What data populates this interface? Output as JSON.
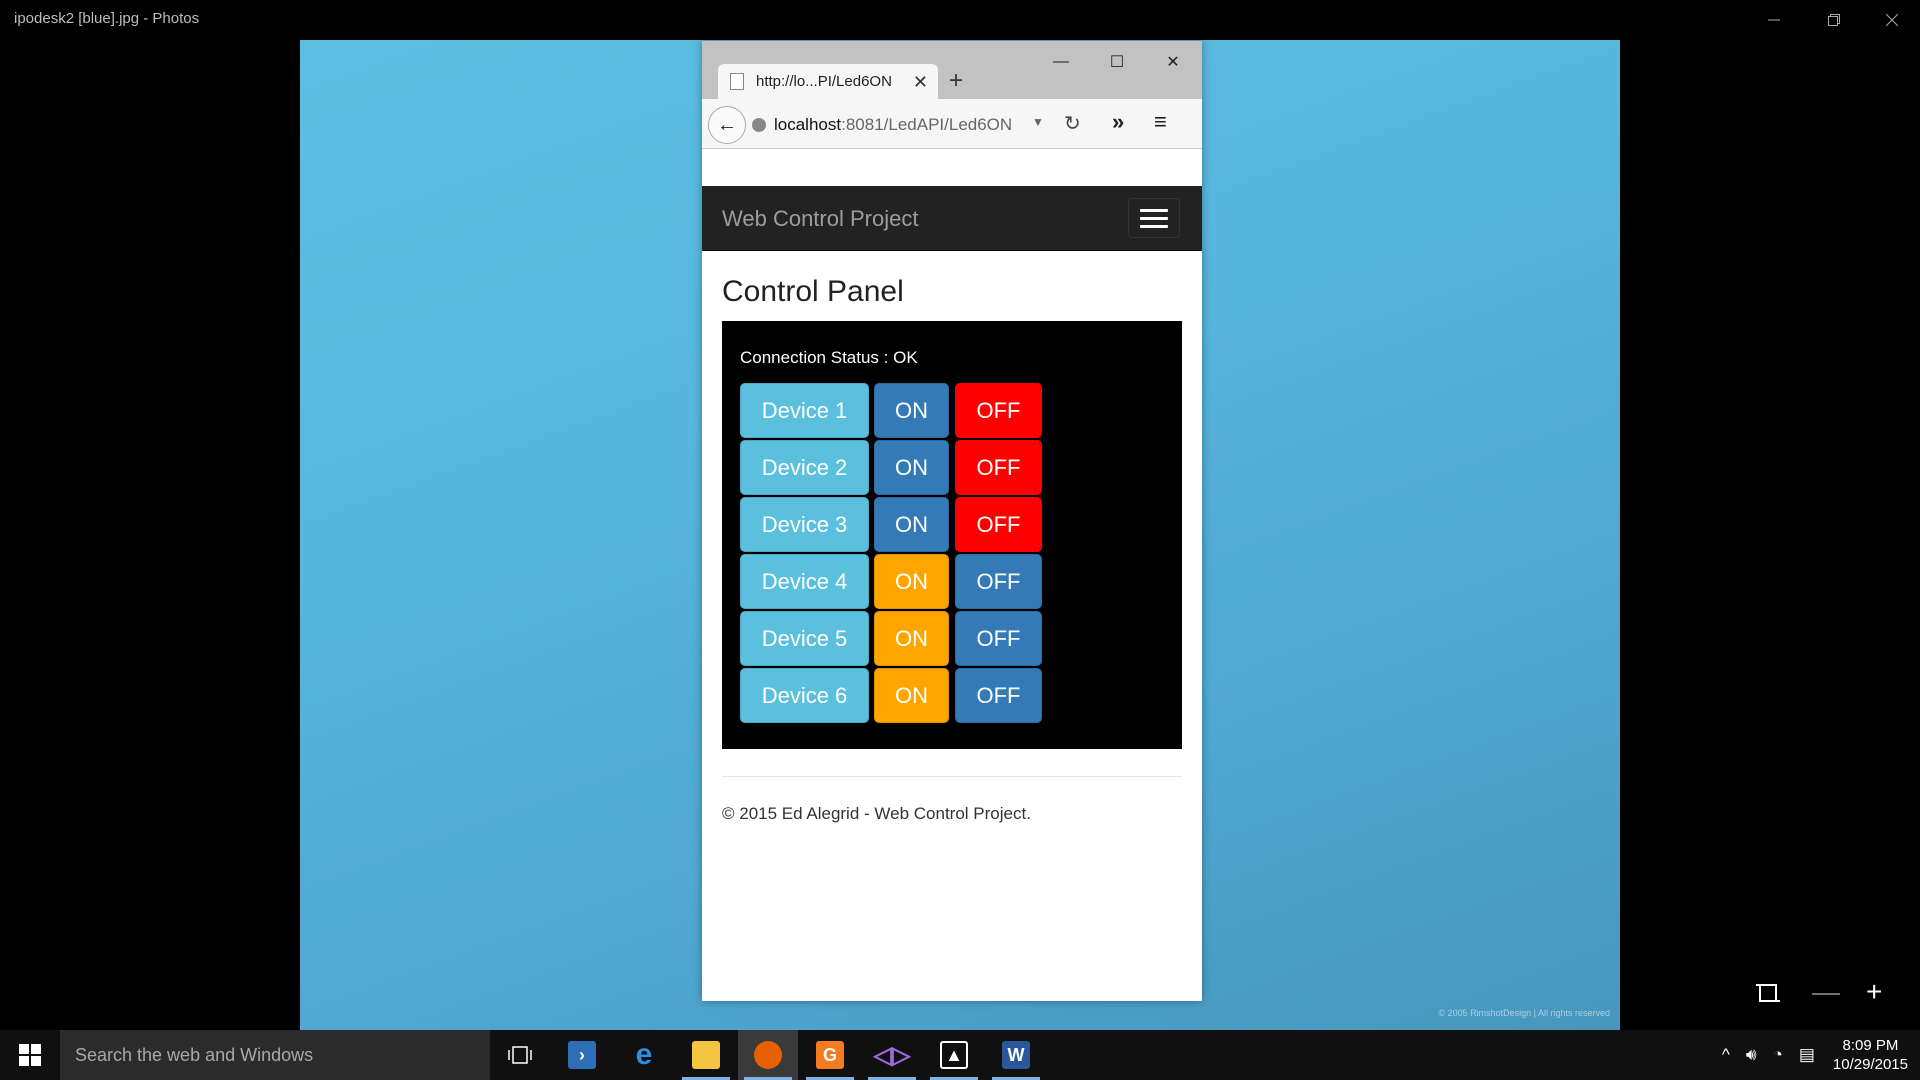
{
  "photos_window": {
    "title": "ipodesk2 [blue].jpg - Photos",
    "minimize_icon": "minimize-icon",
    "restore_icon": "restore-icon",
    "close_icon": "close-icon"
  },
  "photo": {
    "credit": "© 2005 RimshotDesign | All rights reserved",
    "background_color": "#58b6dc"
  },
  "browser": {
    "tab_title": "http://lo...PI/Led6ON",
    "new_tab": "+",
    "url_host": "localhost",
    "url_path": ":8081/LedAPI/Led6ON",
    "back_icon": "back-arrow-icon",
    "reload_icon": "reload-icon",
    "overflow_icon": "chevron-double-right-icon",
    "menu_icon": "hamburger-menu-icon"
  },
  "page": {
    "brand": "Web Control Project",
    "heading": "Control Panel",
    "connection_status": "Connection Status : OK",
    "devices": [
      {
        "label": "Device 1",
        "on": "ON",
        "off": "OFF",
        "state": "off"
      },
      {
        "label": "Device 2",
        "on": "ON",
        "off": "OFF",
        "state": "off"
      },
      {
        "label": "Device 3",
        "on": "ON",
        "off": "OFF",
        "state": "off"
      },
      {
        "label": "Device 4",
        "on": "ON",
        "off": "OFF",
        "state": "on"
      },
      {
        "label": "Device 5",
        "on": "ON",
        "off": "OFF",
        "state": "on"
      },
      {
        "label": "Device 6",
        "on": "ON",
        "off": "OFF",
        "state": "on"
      }
    ],
    "footer": "© 2015 Ed Alegrid - Web Control Project.",
    "colors": {
      "device": "#5bc0de",
      "primary": "#337ab7",
      "off_active": "#ff0000",
      "on_active": "#ffa500",
      "navbar": "#222222"
    }
  },
  "taskbar": {
    "search_placeholder": "Search the web and Windows",
    "apps": [
      "task-view",
      "powershell",
      "edge",
      "file-explorer",
      "firefox",
      "pdf-app",
      "visual-studio",
      "photos",
      "word"
    ],
    "time": "8:09 PM",
    "date": "10/29/2015"
  }
}
